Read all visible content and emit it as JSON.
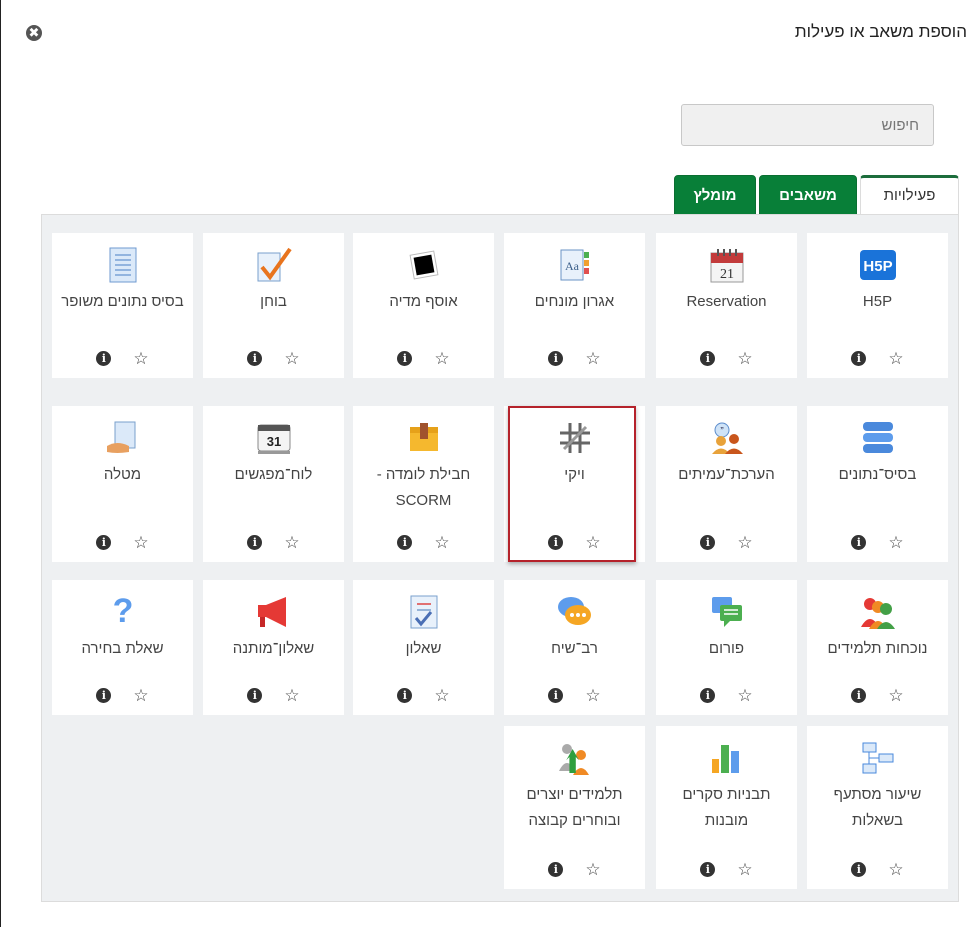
{
  "dialog": {
    "title": "הוספת משאב או פעילות",
    "close_glyph": "✖"
  },
  "search": {
    "placeholder": "חיפוש"
  },
  "tabs": [
    {
      "label": "פעילויות",
      "active": true
    },
    {
      "label": "משאבים",
      "active": false
    },
    {
      "label": "מומלץ",
      "active": false
    }
  ],
  "modules": [
    {
      "name": "H5P",
      "icon": "h5p-icon"
    },
    {
      "name": "Reservation",
      "icon": "calendar-icon"
    },
    {
      "name": "אגרון מונחים",
      "icon": "glossary-icon"
    },
    {
      "name": "אוסף מדיה",
      "icon": "media-collection-icon"
    },
    {
      "name": "בוחן",
      "icon": "quiz-icon"
    },
    {
      "name": "בסיס נתונים משופר",
      "icon": "document-icon"
    },
    {
      "name": "בסיס־נתונים",
      "icon": "database-icon"
    },
    {
      "name": "הערכת־עמיתים",
      "icon": "peer-assessment-icon"
    },
    {
      "name": "ויקי",
      "icon": "wiki-icon"
    },
    {
      "name": "חבילת לומדה - SCORM",
      "icon": "scorm-package-icon"
    },
    {
      "name": "לוח־מפגשים",
      "icon": "scheduler-icon"
    },
    {
      "name": "מטלה",
      "icon": "assignment-icon"
    },
    {
      "name": "נוכחות תלמידים",
      "icon": "attendance-icon"
    },
    {
      "name": "פורום",
      "icon": "forum-icon"
    },
    {
      "name": "רב־שיח",
      "icon": "chat-icon"
    },
    {
      "name": "שאלון",
      "icon": "questionnaire-icon"
    },
    {
      "name": "שאלון־מותנה",
      "icon": "megaphone-icon"
    },
    {
      "name": "שאלת בחירה",
      "icon": "question-mark-icon"
    },
    {
      "name": "שיעור מסתעף בשאלות",
      "icon": "lesson-icon"
    },
    {
      "name": "תבניות סקרים מובנות",
      "icon": "survey-chart-icon"
    },
    {
      "name": "תלמידים יוצרים ובוחרים קבוצה",
      "icon": "group-choice-icon"
    }
  ],
  "card_actions": {
    "info_glyph": "i",
    "star_glyph": "☆"
  },
  "highlighted_module": "ויקי"
}
